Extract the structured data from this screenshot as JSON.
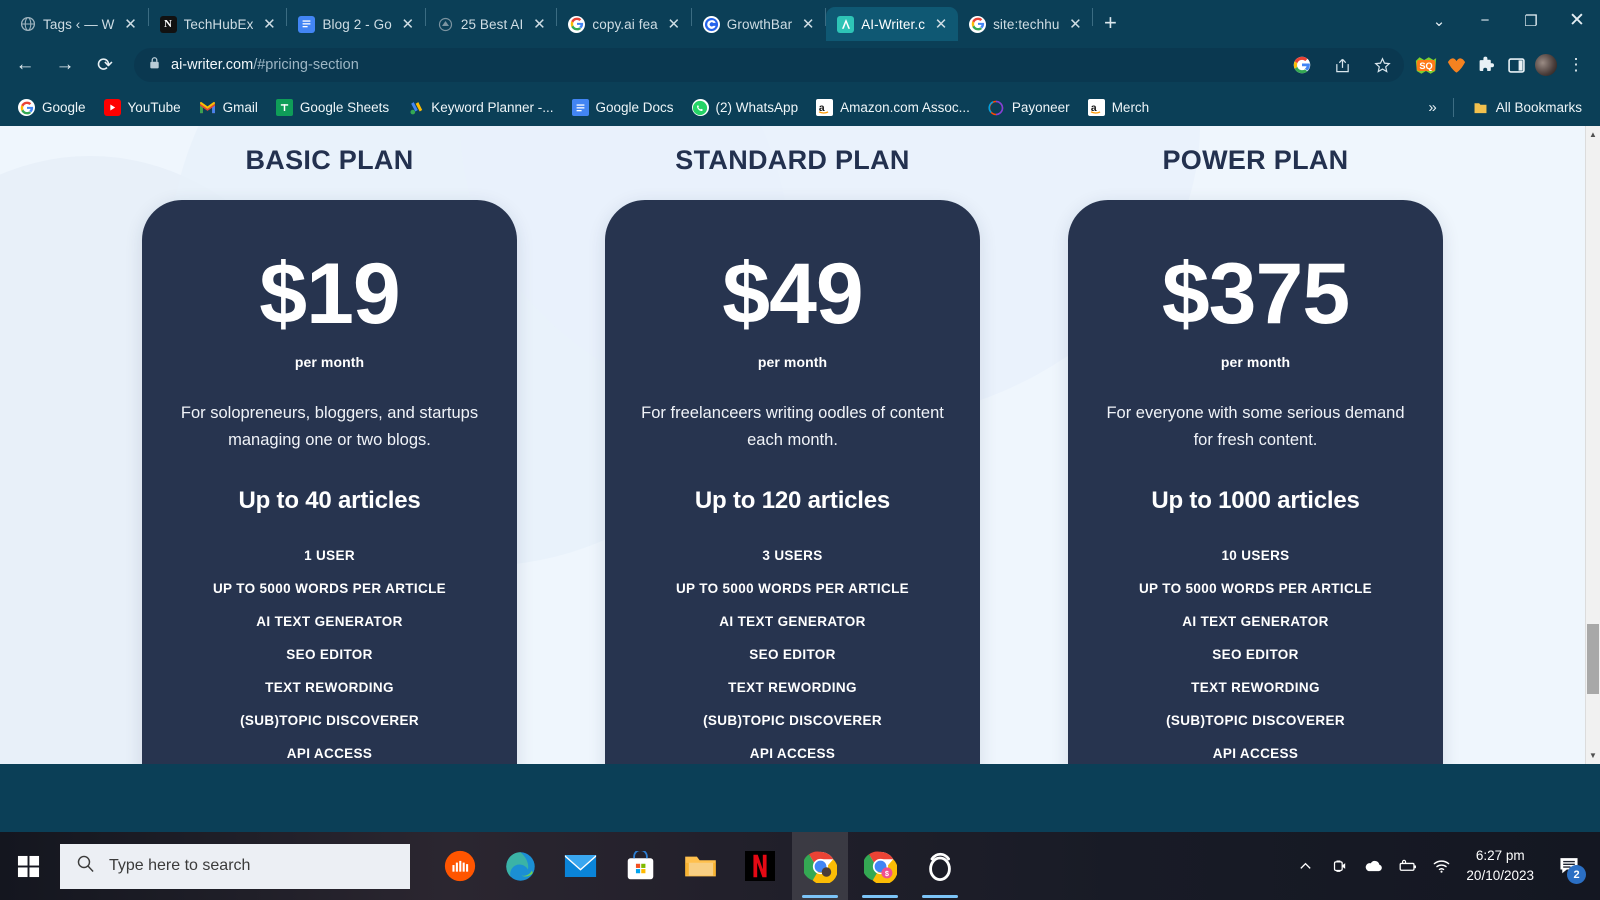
{
  "browser": {
    "tabs": [
      {
        "title": "Tags ‹ — W",
        "icon": "globe-icon",
        "active": false
      },
      {
        "title": "TechHubEx",
        "icon": "notion-icon",
        "active": false
      },
      {
        "title": "Blog 2 - Go",
        "icon": "google-docs-icon",
        "active": false
      },
      {
        "title": "25 Best AI",
        "icon": "generic-site-icon",
        "active": false
      },
      {
        "title": "copy.ai fea",
        "icon": "google-icon",
        "active": false
      },
      {
        "title": "GrowthBar",
        "icon": "growthbar-icon",
        "active": false
      },
      {
        "title": "AI-Writer.c",
        "icon": "ai-writer-icon",
        "active": true
      },
      {
        "title": "site:techhu",
        "icon": "google-icon",
        "active": false
      }
    ],
    "new_tab_label": "+",
    "window_controls": {
      "list": "⌄",
      "minimize": "−",
      "restore": "❐",
      "close": "✕"
    },
    "nav": {
      "back": "←",
      "forward": "→",
      "reload": "⟳"
    },
    "omnibox": {
      "lock": "🔒",
      "url_host": "ai-writer.com",
      "url_path": "/#pricing-section",
      "full_url": "ai-writer.com/#pricing-section"
    },
    "omnibox_actions": [
      {
        "name": "google-lens-icon",
        "glyph": "G"
      },
      {
        "name": "share-icon",
        "glyph": "↗"
      },
      {
        "name": "bookmark-star-icon",
        "glyph": "☆"
      }
    ],
    "toolbar_extensions": [
      {
        "name": "seoquake-extension-icon",
        "glyph": "SQ"
      },
      {
        "name": "mozbar-extension-icon",
        "glyph": "✹"
      },
      {
        "name": "extensions-puzzle-icon",
        "glyph": "🧩"
      },
      {
        "name": "side-panel-icon",
        "glyph": "▣"
      }
    ],
    "profile_label": "",
    "menu_glyph": "⋮",
    "bookmarks": [
      {
        "label": "Google",
        "icon": "google-icon"
      },
      {
        "label": "YouTube",
        "icon": "youtube-icon"
      },
      {
        "label": "Gmail",
        "icon": "gmail-icon"
      },
      {
        "label": "Google Sheets",
        "icon": "google-sheets-icon"
      },
      {
        "label": "Keyword Planner -...",
        "icon": "google-ads-icon"
      },
      {
        "label": "Google Docs",
        "icon": "google-docs-icon"
      },
      {
        "label": "(2) WhatsApp",
        "icon": "whatsapp-icon"
      },
      {
        "label": "Amazon.com Assoc...",
        "icon": "amazon-icon"
      },
      {
        "label": "Payoneer",
        "icon": "payoneer-icon"
      },
      {
        "label": "Merch",
        "icon": "amazon-icon"
      }
    ],
    "bookmarks_overflow": "»",
    "all_bookmarks_label": "All Bookmarks"
  },
  "page": {
    "plans": [
      {
        "title": "BASIC PLAN",
        "price": "$19",
        "period": "per month",
        "description": "For solopreneurs, bloggers, and startups managing one or two blogs.",
        "articles": "Up to 40 articles",
        "features": [
          "1 USER",
          "UP TO 5000 WORDS PER ARTICLE",
          "AI TEXT GENERATOR",
          "SEO EDITOR",
          "TEXT REWORDING",
          "(SUB)TOPIC DISCOVERER",
          "API ACCESS"
        ]
      },
      {
        "title": "STANDARD PLAN",
        "price": "$49",
        "period": "per month",
        "description": "For freelanceers writing oodles of content each month.",
        "articles": "Up to 120 articles",
        "features": [
          "3 USERS",
          "UP TO 5000 WORDS PER ARTICLE",
          "AI TEXT GENERATOR",
          "SEO EDITOR",
          "TEXT REWORDING",
          "(SUB)TOPIC DISCOVERER",
          "API ACCESS"
        ]
      },
      {
        "title": "POWER PLAN",
        "price": "$375",
        "period": "per month",
        "description": "For everyone with some serious demand for fresh content.",
        "articles": "Up to 1000 articles",
        "features": [
          "10 USERS",
          "UP TO 5000 WORDS PER ARTICLE",
          "AI TEXT GENERATOR",
          "SEO EDITOR",
          "TEXT REWORDING",
          "(SUB)TOPIC DISCOVERER",
          "API ACCESS"
        ]
      }
    ],
    "colors": {
      "card_bg": "#27344f",
      "page_bg": "#eff6fd",
      "heading": "#23314f"
    }
  },
  "taskbar": {
    "start_label": "Start",
    "search_placeholder": "Type here to search",
    "apps": [
      {
        "name": "soundcloud-taskbar-icon",
        "state": "pinned"
      },
      {
        "name": "microsoft-edge-taskbar-icon",
        "state": "pinned"
      },
      {
        "name": "mail-taskbar-icon",
        "state": "pinned"
      },
      {
        "name": "microsoft-store-taskbar-icon",
        "state": "pinned"
      },
      {
        "name": "file-explorer-taskbar-icon",
        "state": "pinned"
      },
      {
        "name": "netflix-taskbar-icon",
        "state": "pinned"
      },
      {
        "name": "google-chrome-taskbar-icon",
        "state": "active"
      },
      {
        "name": "google-chrome-profile-taskbar-icon",
        "state": "open"
      },
      {
        "name": "opera-taskbar-icon",
        "state": "open"
      }
    ],
    "tray": [
      {
        "name": "show-hidden-icons-chevron",
        "glyph": "⌃"
      },
      {
        "name": "webcam-tray-icon",
        "glyph": "📷"
      },
      {
        "name": "onedrive-tray-icon",
        "glyph": "☁"
      },
      {
        "name": "battery-tray-icon",
        "glyph": "🔋"
      },
      {
        "name": "wifi-tray-icon",
        "glyph": "📶"
      }
    ],
    "clock_time": "6:27 pm",
    "clock_date": "20/10/2023",
    "notification_count": "2"
  }
}
